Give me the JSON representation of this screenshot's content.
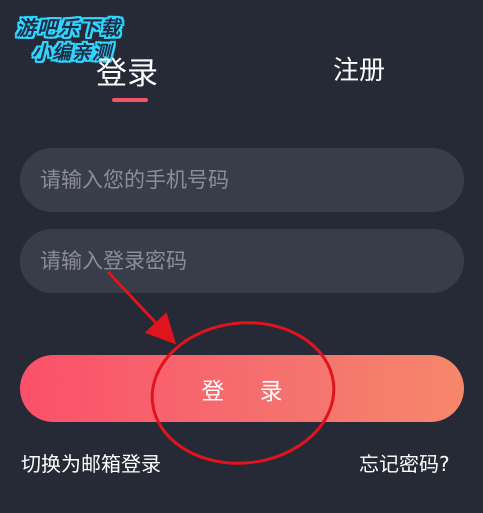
{
  "watermark": {
    "line1": "游吧乐下载",
    "line2": "小编亲测"
  },
  "tabs": {
    "login": "登录",
    "register": "注册"
  },
  "inputs": {
    "phone_placeholder": "请输入您的手机号码",
    "password_placeholder": "请输入登录密码"
  },
  "login_button": "登 录",
  "links": {
    "switch_email": "切换为邮箱登录",
    "forgot_password": "忘记密码?"
  },
  "colors": {
    "background": "#252a36",
    "input_bg": "#393d49",
    "accent": "#ef5468",
    "annotation_red": "#e0141c"
  }
}
